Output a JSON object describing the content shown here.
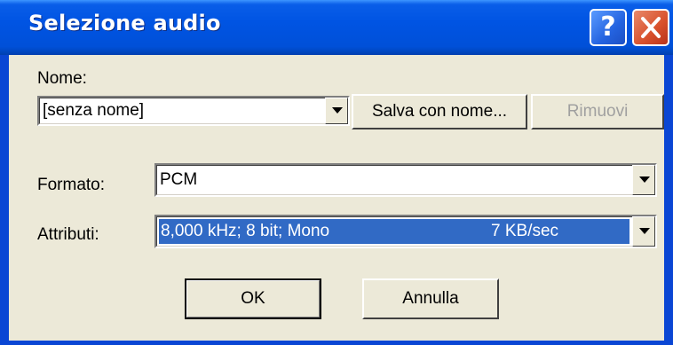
{
  "window": {
    "title": "Selezione audio"
  },
  "name_label": "Nome:",
  "name_combo": {
    "value": "[senza nome]"
  },
  "save_as_button": "Salva con nome...",
  "remove_button": "Rimuovi",
  "format": {
    "label": "Formato:",
    "value": "PCM"
  },
  "attributes": {
    "label": "Attributi:",
    "value": "8,000 kHz; 8 bit; Mono",
    "rate": "7 KB/sec"
  },
  "ok_button": "OK",
  "cancel_button": "Annulla",
  "colors": {
    "title_bar": "#0054e3",
    "selection": "#316ac5",
    "face": "#ece9d8",
    "close": "#d8502c"
  }
}
